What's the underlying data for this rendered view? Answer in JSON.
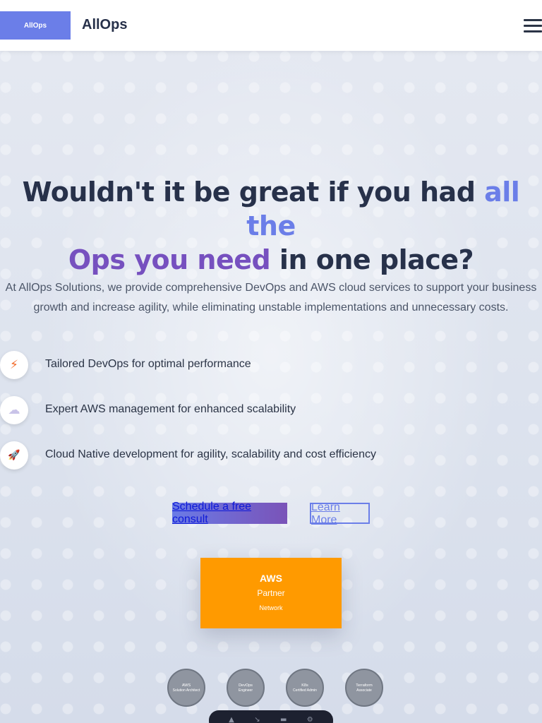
{
  "navbar": {
    "logo_text": "AllOps",
    "brand": "AllOps",
    "menu_icon": "hamburger-menu-icon"
  },
  "hero": {
    "headline_part1": "Wouldn't it be great if you had ",
    "headline_highlight1": "all the",
    "headline_highlight2": "Ops you need",
    "headline_part2": " in one place?",
    "subtext": "At AllOps Solutions, we provide comprehensive DevOps and AWS cloud services to support your business growth and increase agility, while eliminating unstable implementations and unnecessary costs."
  },
  "features": [
    {
      "icon": "lightning-icon",
      "glyph": "⚡",
      "label": "Tailored DevOps for optimal performance"
    },
    {
      "icon": "cloud-icon",
      "glyph": "☁",
      "label": "Expert AWS management for enhanced scalability"
    },
    {
      "icon": "rocket-icon",
      "glyph": "🚀",
      "label": "Cloud Native development for agility, scalability and cost efficiency"
    }
  ],
  "buttons": {
    "primary": "Schedule a free consult",
    "secondary": "Learn More"
  },
  "aws_card": {
    "line1": "AWS",
    "line2": "Partner",
    "line3": "Network"
  },
  "certifications": [
    {
      "line1": "AWS",
      "line2": "Solution Architect"
    },
    {
      "line1": "DevOps",
      "line2": "Engineer"
    },
    {
      "line1": "K8s",
      "line2": "Certified Admin"
    },
    {
      "line1": "Terraform",
      "line2": "Associate"
    }
  ],
  "colors": {
    "accent": "#6b7ee8",
    "accent_purple": "#7650bf",
    "aws_orange": "#ff9a00",
    "text_dark": "#27314a"
  }
}
